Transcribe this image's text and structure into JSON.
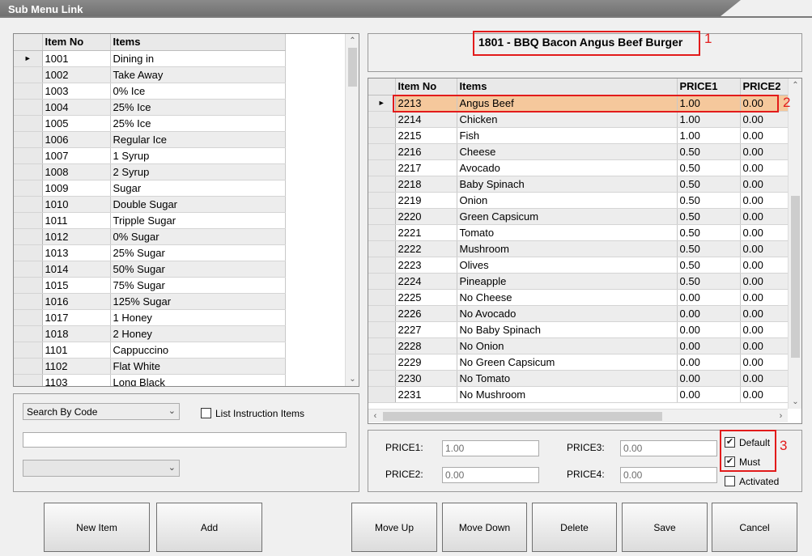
{
  "window": {
    "title": "Sub Menu Link"
  },
  "left_grid": {
    "columns": [
      "Item No",
      "Items"
    ],
    "rows": [
      {
        "no": "1001",
        "item": "Dining in"
      },
      {
        "no": "1002",
        "item": "Take Away"
      },
      {
        "no": "1003",
        "item": "0% Ice"
      },
      {
        "no": "1004",
        "item": "25% Ice"
      },
      {
        "no": "1005",
        "item": "25% Ice"
      },
      {
        "no": "1006",
        "item": "Regular Ice"
      },
      {
        "no": "1007",
        "item": "1 Syrup"
      },
      {
        "no": "1008",
        "item": "2 Syrup"
      },
      {
        "no": "1009",
        "item": "Sugar"
      },
      {
        "no": "1010",
        "item": "Double Sugar"
      },
      {
        "no": "1011",
        "item": "Tripple Sugar"
      },
      {
        "no": "1012",
        "item": "0% Sugar"
      },
      {
        "no": "1013",
        "item": "25% Sugar"
      },
      {
        "no": "1014",
        "item": "50% Sugar"
      },
      {
        "no": "1015",
        "item": "75% Sugar"
      },
      {
        "no": "1016",
        "item": "125% Sugar"
      },
      {
        "no": "1017",
        "item": "1 Honey"
      },
      {
        "no": "1018",
        "item": "2 Honey"
      },
      {
        "no": "1101",
        "item": "Cappuccino"
      },
      {
        "no": "1102",
        "item": "Flat White"
      },
      {
        "no": "1103",
        "item": "Long Black"
      }
    ]
  },
  "search": {
    "mode": "Search By Code",
    "list_instruction_label": "List Instruction Items",
    "text": "",
    "secondary_select": ""
  },
  "header": {
    "title": "1801 - BBQ Bacon Angus Beef Burger"
  },
  "right_grid": {
    "columns": [
      "Item No",
      "Items",
      "PRICE1",
      "PRICE2"
    ],
    "rows": [
      {
        "no": "2213",
        "item": "Angus Beef",
        "p1": "1.00",
        "p2": "0.00"
      },
      {
        "no": "2214",
        "item": "Chicken",
        "p1": "1.00",
        "p2": "0.00"
      },
      {
        "no": "2215",
        "item": "Fish",
        "p1": "1.00",
        "p2": "0.00"
      },
      {
        "no": "2216",
        "item": "Cheese",
        "p1": "0.50",
        "p2": "0.00"
      },
      {
        "no": "2217",
        "item": "Avocado",
        "p1": "0.50",
        "p2": "0.00"
      },
      {
        "no": "2218",
        "item": "Baby Spinach",
        "p1": "0.50",
        "p2": "0.00"
      },
      {
        "no": "2219",
        "item": "Onion",
        "p1": "0.50",
        "p2": "0.00"
      },
      {
        "no": "2220",
        "item": "Green Capsicum",
        "p1": "0.50",
        "p2": "0.00"
      },
      {
        "no": "2221",
        "item": "Tomato",
        "p1": "0.50",
        "p2": "0.00"
      },
      {
        "no": "2222",
        "item": "Mushroom",
        "p1": "0.50",
        "p2": "0.00"
      },
      {
        "no": "2223",
        "item": "Olives",
        "p1": "0.50",
        "p2": "0.00"
      },
      {
        "no": "2224",
        "item": "Pineapple",
        "p1": "0.50",
        "p2": "0.00"
      },
      {
        "no": "2225",
        "item": "No Cheese",
        "p1": "0.00",
        "p2": "0.00"
      },
      {
        "no": "2226",
        "item": "No Avocado",
        "p1": "0.00",
        "p2": "0.00"
      },
      {
        "no": "2227",
        "item": "No Baby Spinach",
        "p1": "0.00",
        "p2": "0.00"
      },
      {
        "no": "2228",
        "item": "No Onion",
        "p1": "0.00",
        "p2": "0.00"
      },
      {
        "no": "2229",
        "item": "No Green Capsicum",
        "p1": "0.00",
        "p2": "0.00"
      },
      {
        "no": "2230",
        "item": "No Tomato",
        "p1": "0.00",
        "p2": "0.00"
      },
      {
        "no": "2231",
        "item": "No Mushroom",
        "p1": "0.00",
        "p2": "0.00"
      }
    ]
  },
  "prices": {
    "price1_label": "PRICE1:",
    "price1": "1.00",
    "price2_label": "PRICE2:",
    "price2": "0.00",
    "price3_label": "PRICE3:",
    "price3": "0.00",
    "price4_label": "PRICE4:",
    "price4": "0.00"
  },
  "options": {
    "default_label": "Default",
    "default_checked": true,
    "must_label": "Must",
    "must_checked": true,
    "activated_label": "Activated",
    "activated_checked": false
  },
  "buttons": {
    "new_item": "New Item",
    "add": "Add",
    "move_up": "Move Up",
    "move_down": "Move Down",
    "delete": "Delete",
    "save": "Save",
    "cancel": "Cancel"
  },
  "annotations": [
    "1",
    "2",
    "3"
  ],
  "colors": {
    "selected_row": "#f5c89c",
    "annotation_red": "#e21b1b"
  },
  "icons": {
    "row_pointer": "triangle-right-icon",
    "dropdown": "chevron-down-icon"
  }
}
